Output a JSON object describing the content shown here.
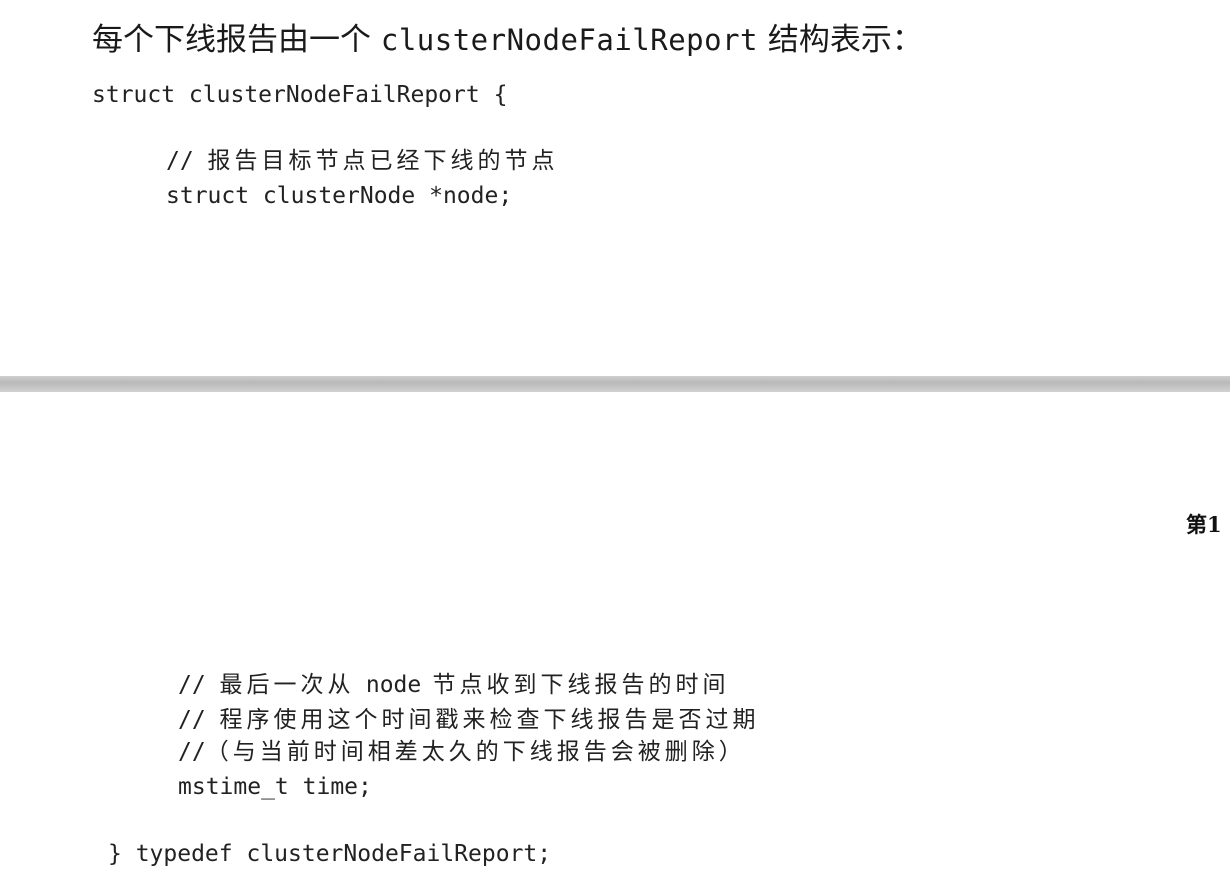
{
  "heading": {
    "prefix": "每个下线报告由一个 ",
    "code_term": "clusterNodeFailReport",
    "suffix": " 结构表示："
  },
  "code_top": {
    "line1": "struct clusterNodeFailReport {",
    "comment1_slashes": "// ",
    "comment1_text": "报告目标节点已经下线的节点",
    "line3": "struct clusterNode *node;"
  },
  "page_number": "第1",
  "code_bottom": {
    "comment2_slashes": "// ",
    "comment2_pre": "最后一次从 ",
    "comment2_code": "node",
    "comment2_post": " 节点收到下线报告的时间",
    "comment3_slashes": "// ",
    "comment3_text": "程序使用这个时间戳来检查下线报告是否过期",
    "comment4_slashes": "//",
    "comment4_text": "（与当前时间相差太久的下线报告会被删除）",
    "line5": "mstime_t time;",
    "line6": "} typedef clusterNodeFailReport;"
  }
}
